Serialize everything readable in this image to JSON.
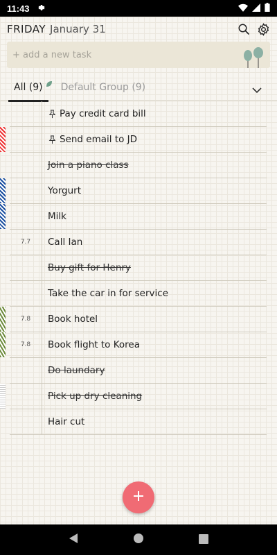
{
  "status": {
    "time": "11:43"
  },
  "header": {
    "day": "FRIDAY",
    "date": "January 31"
  },
  "add_task": {
    "placeholder": "+ add a new task"
  },
  "tabs": [
    {
      "label": "All (9)"
    },
    {
      "label": "Default Group (9)"
    }
  ],
  "tasks": [
    {
      "title": "Pay credit card bill",
      "date": "",
      "done": false,
      "pinned": true,
      "marker": ""
    },
    {
      "title": "Send email to JD",
      "date": "",
      "done": false,
      "pinned": true,
      "marker": "red"
    },
    {
      "title": "Join a piano class",
      "date": "",
      "done": true,
      "pinned": false,
      "marker": ""
    },
    {
      "title": "Yorgurt",
      "date": "",
      "done": false,
      "pinned": false,
      "marker": "blue"
    },
    {
      "title": "Milk",
      "date": "",
      "done": false,
      "pinned": false,
      "marker": "blue"
    },
    {
      "title": "Call Ian",
      "date": "7.7",
      "done": false,
      "pinned": false,
      "marker": ""
    },
    {
      "title": "Buy gift for Henry",
      "date": "",
      "done": true,
      "pinned": false,
      "marker": ""
    },
    {
      "title": "Take the car in for service",
      "date": "",
      "done": false,
      "pinned": false,
      "marker": ""
    },
    {
      "title": "Book hotel",
      "date": "7.8",
      "done": false,
      "pinned": false,
      "marker": "green"
    },
    {
      "title": "Book flight to Korea",
      "date": "7.8",
      "done": false,
      "pinned": false,
      "marker": "green"
    },
    {
      "title": "Do laundary",
      "date": "",
      "done": true,
      "pinned": false,
      "marker": ""
    },
    {
      "title": "Pick up dry cleaning",
      "date": "",
      "done": true,
      "pinned": false,
      "marker": "grey"
    },
    {
      "title": "Hair cut",
      "date": "",
      "done": false,
      "pinned": false,
      "marker": ""
    }
  ],
  "colors": {
    "fab": "#f06b74",
    "background": "#f7f5f0",
    "input_bg": "#ebe6d7"
  }
}
